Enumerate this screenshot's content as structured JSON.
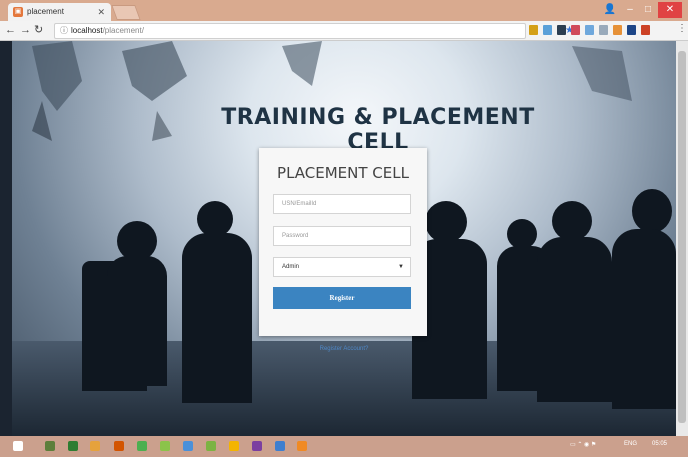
{
  "browser": {
    "tab_title": "placement",
    "url_host": "localhost",
    "url_path": "/placement/"
  },
  "page": {
    "heading": "TRAINING & PLACEMENT CELL",
    "card_title": "PLACEMENT CELL",
    "usn_placeholder": "USN/EmailId",
    "password_placeholder": "Password",
    "role_selected": "Admin",
    "register_button": "Register",
    "register_account_link": "Register Account?"
  },
  "taskbar": {
    "lang": "ENG",
    "time": "05:05"
  },
  "colors": {
    "button": "#3b84c1",
    "chrome": "#d9aa8f",
    "taskbar": "#cba08d"
  }
}
